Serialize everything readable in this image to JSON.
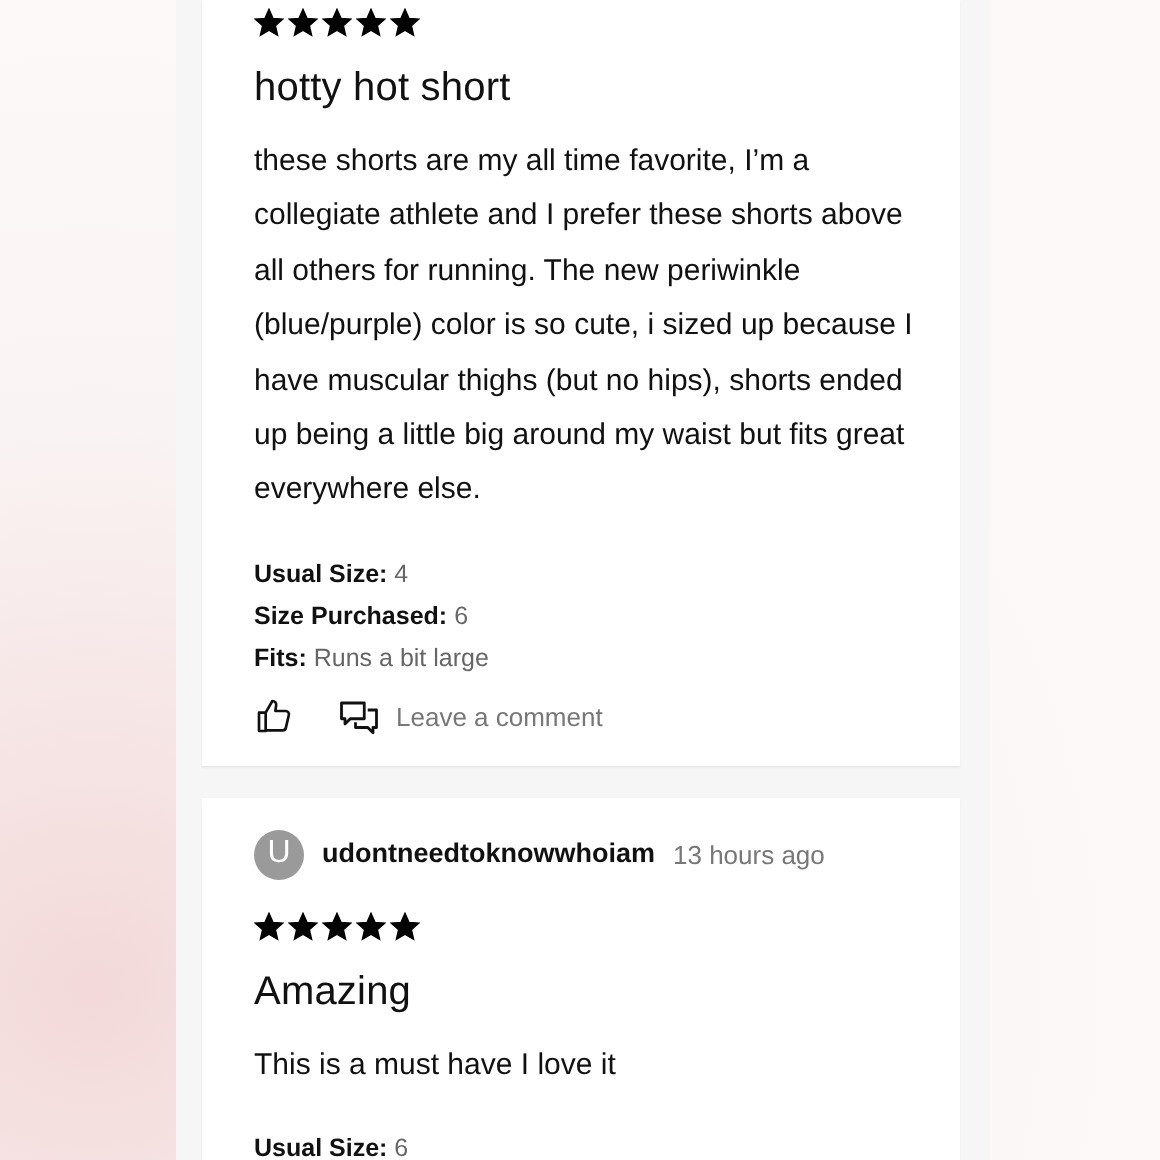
{
  "reviews": [
    {
      "stars": 5,
      "title": "hotty hot short",
      "body": "these shorts are my all time favorite, I’m a collegiate athlete and I prefer these shorts above all others for running. The new periwinkle (blue/purple) color is so cute, i sized up because I have muscular thighs (but no hips), shorts ended up being a little big around my waist but fits great everywhere else.",
      "details": [
        {
          "label": "Usual Size:",
          "value": "4"
        },
        {
          "label": "Size Purchased:",
          "value": "6"
        },
        {
          "label": "Fits:",
          "value": "Runs a bit large"
        }
      ],
      "comment_label": "Leave a comment"
    },
    {
      "author": {
        "initial": "U",
        "name": "udontneedtoknowwhoiam"
      },
      "time": "13 hours ago",
      "stars": 5,
      "title": "Amazing",
      "body": "This is a must have I love it",
      "details": [
        {
          "label": "Usual Size:",
          "value": "6"
        }
      ]
    }
  ]
}
